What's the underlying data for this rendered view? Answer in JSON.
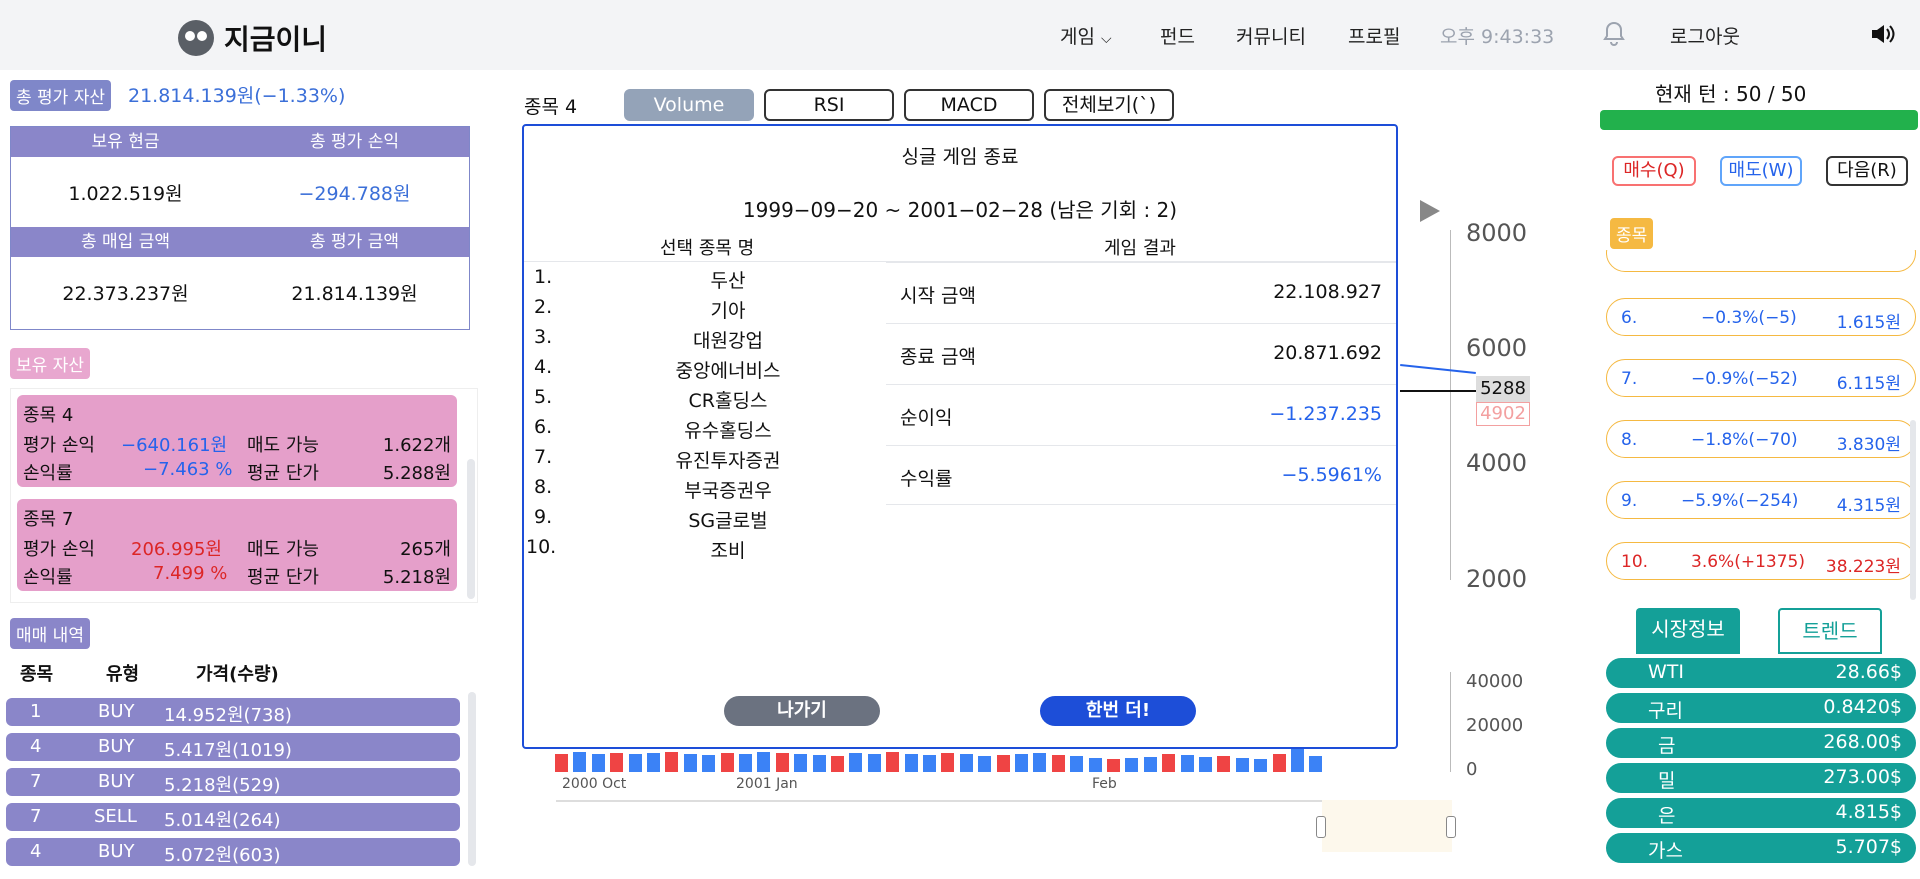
{
  "header": {
    "logo": "지금이니",
    "nav": [
      "게임",
      "펀드",
      "커뮤니티",
      "프로필"
    ],
    "clock": "오후 9:43:33",
    "logout": "로그아웃"
  },
  "left": {
    "total_label": "총 평가 자산",
    "total_value": "21.814.139원(−1.33%)",
    "summary": {
      "h1a": "보유 현금",
      "h1b": "총 평가 손익",
      "v1a": "1.022.519원",
      "v1b": "−294.788원",
      "h2a": "총 매입 금액",
      "h2b": "총 평가 금액",
      "v2a": "22.373.237원",
      "v2b": "21.814.139원"
    },
    "holding_title": "보유 자산",
    "holdings": [
      {
        "name": "종목 4",
        "pl_label": "평가 손익",
        "pl": "−640.161원",
        "sell_label": "매도 가능",
        "sell": "1.622개",
        "rate_label": "손익률",
        "rate": "−7.463 %",
        "avg_label": "평균 단가",
        "avg": "5.288원"
      },
      {
        "name": "종목 7",
        "pl_label": "평가 손익",
        "pl": "206.995원",
        "sell_label": "매도 가능",
        "sell": "265개",
        "rate_label": "손익률",
        "rate": "7.499 %",
        "avg_label": "평균 단가",
        "avg": "5.218원"
      }
    ],
    "trade_title": "매매 내역",
    "trade_headers": [
      "종목",
      "유형",
      "가격(수량)"
    ],
    "trades": [
      {
        "stock": "1",
        "type": "BUY",
        "price": "14.952원(738)"
      },
      {
        "stock": "4",
        "type": "BUY",
        "price": "5.417원(1019)"
      },
      {
        "stock": "7",
        "type": "BUY",
        "price": "5.218원(529)"
      },
      {
        "stock": "7",
        "type": "SELL",
        "price": "5.014원(264)"
      },
      {
        "stock": "4",
        "type": "BUY",
        "price": "5.072원(603)"
      }
    ]
  },
  "center": {
    "title": "종목 4",
    "buttons": [
      "Volume",
      "RSI",
      "MACD",
      "전체보기(`)"
    ],
    "y_axis": [
      "8000",
      "6000",
      "4000",
      "2000"
    ],
    "vol_axis": [
      "40000",
      "20000",
      "0"
    ],
    "price_tag": "5288",
    "price_tag2": "4902",
    "dates": [
      "2000 Oct",
      "2001 Jan",
      "Feb"
    ]
  },
  "modal": {
    "title": "싱글 게임 종료",
    "range": "1999−09−20 ~ 2001−02−28 (남은 기회 : 2)",
    "col_left": "선택 종목 명",
    "col_right": "게임 결과",
    "stocks": [
      "두산",
      "기아",
      "대원강업",
      "중앙에너비스",
      "CR홀딩스",
      "유수홀딩스",
      "유진투자증권",
      "부국증권우",
      "SG글로벌",
      "조비"
    ],
    "results": [
      {
        "label": "시작 금액",
        "value": "22.108.927"
      },
      {
        "label": "종료 금액",
        "value": "20.871.692"
      },
      {
        "label": "순이익",
        "value": "−1.237.235"
      },
      {
        "label": "수익률",
        "value": "−5.5961%"
      }
    ],
    "exit": "나가기",
    "again": "한번 더!"
  },
  "right": {
    "turn": "현재 턴 : 50 / 50",
    "progress": 1.0,
    "buy": "매수(Q)",
    "sell": "매도(W)",
    "next": "다음(R)",
    "stock_title": "종목",
    "ranks": [
      {
        "n": "6.",
        "chg": "−0.3%(−5)",
        "price": "1.615원",
        "color": "#2563eb"
      },
      {
        "n": "7.",
        "chg": "−0.9%(−52)",
        "price": "6.115원",
        "color": "#2563eb"
      },
      {
        "n": "8.",
        "chg": "−1.8%(−70)",
        "price": "3.830원",
        "color": "#2563eb"
      },
      {
        "n": "9.",
        "chg": "−5.9%(−254)",
        "price": "4.315원",
        "color": "#2563eb"
      },
      {
        "n": "10.",
        "chg": "3.6%(+1375)",
        "price": "38.223원",
        "color": "#dc2626"
      }
    ],
    "tabs": [
      "시장정보",
      "트렌드"
    ],
    "market": [
      {
        "name": "WTI",
        "value": "28.66$"
      },
      {
        "name": "구리",
        "value": "0.8420$"
      },
      {
        "name": "금",
        "value": "268.00$"
      },
      {
        "name": "밀",
        "value": "273.00$"
      },
      {
        "name": "은",
        "value": "4.815$"
      },
      {
        "name": "가스",
        "value": "5.707$"
      }
    ]
  },
  "colors": {
    "blue": "#3b6fd8",
    "red": "#e53935",
    "purple": "#8a86c9",
    "pink": "#e59fca",
    "teal": "#14a098",
    "green": "#22b14c"
  }
}
